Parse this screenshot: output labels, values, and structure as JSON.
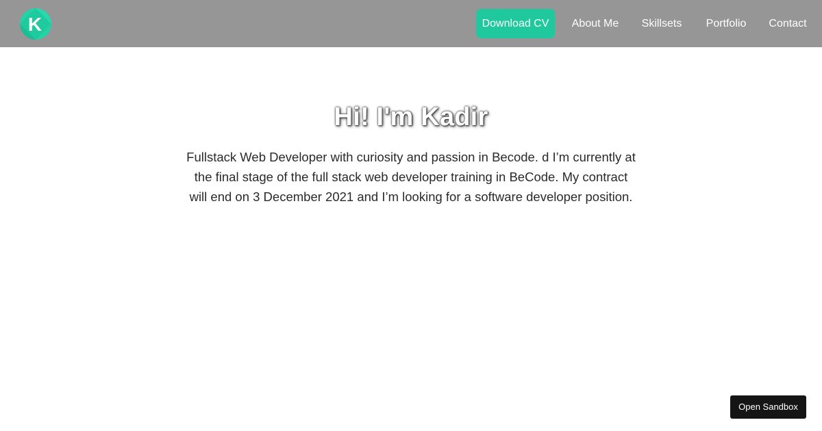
{
  "header": {
    "logo_letter": "K",
    "logo_colors": {
      "primary": "#22d3a6",
      "secondary": "#18b08b",
      "letter": "#ffffff"
    },
    "nav": {
      "download_cv": "Download CV",
      "about": "About Me",
      "skills": "Skillsets",
      "portfolio": "Portfolio",
      "contact": "Contact"
    },
    "accent_color": "#1fc99d",
    "bar_color": "#969696"
  },
  "hero": {
    "title": "Hi! I'm Kadir",
    "description": "Fullstack Web Developer with curiosity and passion in Becode. d I’m currently at the final stage of the full stack web developer training in BeCode. My contract will end on 3 December 2021 and I’m looking for a software developer position."
  },
  "sandbox": {
    "label": "Open Sandbox"
  }
}
